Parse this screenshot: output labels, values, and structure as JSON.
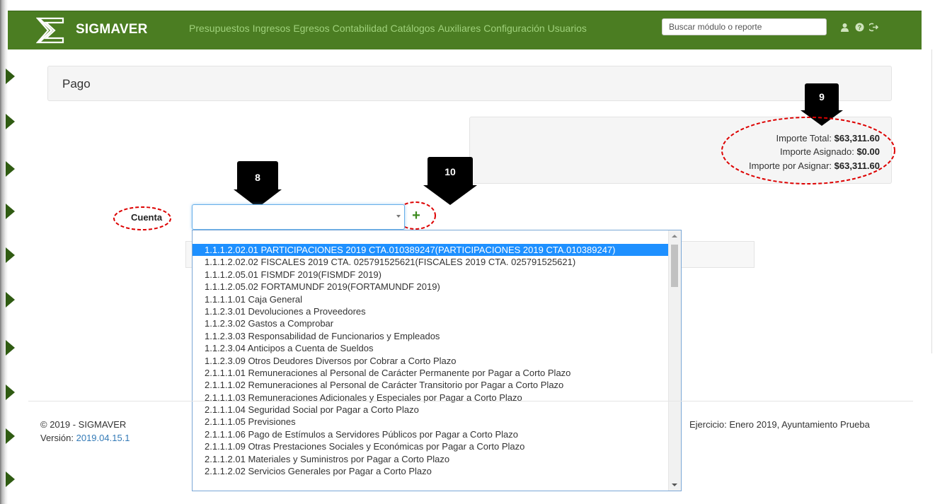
{
  "nav": {
    "brand": "SIGMAVER",
    "items": [
      "Presupuestos",
      "Ingresos",
      "Egresos",
      "Contabilidad",
      "Catálogos",
      "Auxiliares",
      "Configuración",
      "Usuarios"
    ],
    "search_placeholder": "Buscar módulo o reporte",
    "icons": [
      "user-icon",
      "help-icon",
      "logout-icon"
    ]
  },
  "page": {
    "title": "Pago"
  },
  "summary": {
    "total_label": "Importe Total:",
    "total_value": "$63,311.60",
    "assigned_label": "Importe Asignado:",
    "assigned_value": "$0.00",
    "pending_label": "Importe por Asignar:",
    "pending_value": "$63,311.60"
  },
  "callouts": {
    "c8": "8",
    "c9": "9",
    "c10": "10"
  },
  "form": {
    "cuenta_label": "Cuenta",
    "cuenta_value": ""
  },
  "dropdown": {
    "options": [
      "1.1.1.2.02.01 PARTICIPACIONES 2019 CTA.010389247(PARTICIPACIONES 2019 CTA.010389247)",
      "1.1.1.2.02.02 FISCALES 2019 CTA. 025791525621(FISCALES 2019 CTA. 025791525621)",
      "1.1.1.2.05.01 FISMDF 2019(FISMDF 2019)",
      "1.1.1.2.05.02 FORTAMUNDF 2019(FORTAMUNDF 2019)",
      "1.1.1.1.01 Caja General",
      "1.1.2.3.01 Devoluciones a Proveedores",
      "1.1.2.3.02 Gastos a Comprobar",
      "1.1.2.3.03 Responsabilidad de Funcionarios y Empleados",
      "1.1.2.3.04 Anticipos a Cuenta de Sueldos",
      "1.1.2.3.09 Otros Deudores Diversos por Cobrar a Corto Plazo",
      "2.1.1.1.01 Remuneraciones al Personal de Carácter Permanente por Pagar a Corto Plazo",
      "2.1.1.1.02 Remuneraciones al Personal de Carácter Transitorio por Pagar a Corto Plazo",
      "2.1.1.1.03 Remuneraciones Adicionales y Especiales por Pagar a Corto Plazo",
      "2.1.1.1.04 Seguridad Social por Pagar a Corto Plazo",
      "2.1.1.1.05 Previsiones",
      "2.1.1.1.06 Pago de Estímulos a Servidores Públicos por Pagar a Corto Plazo",
      "2.1.1.1.09 Otras Prestaciones Sociales y Económicas por Pagar a Corto Plazo",
      "2.1.1.2.01 Materiales y Suministros por Pagar a Corto Plazo",
      "2.1.1.2.02 Servicios Generales por Pagar a Corto Plazo"
    ],
    "selected_index": 0
  },
  "footer": {
    "copyright": "© 2019 - SIGMAVER",
    "version_label": "Versión:",
    "version_value": "2019.04.15.1",
    "exercise": "Ejercicio: Enero 2019, Ayuntamiento Prueba"
  }
}
